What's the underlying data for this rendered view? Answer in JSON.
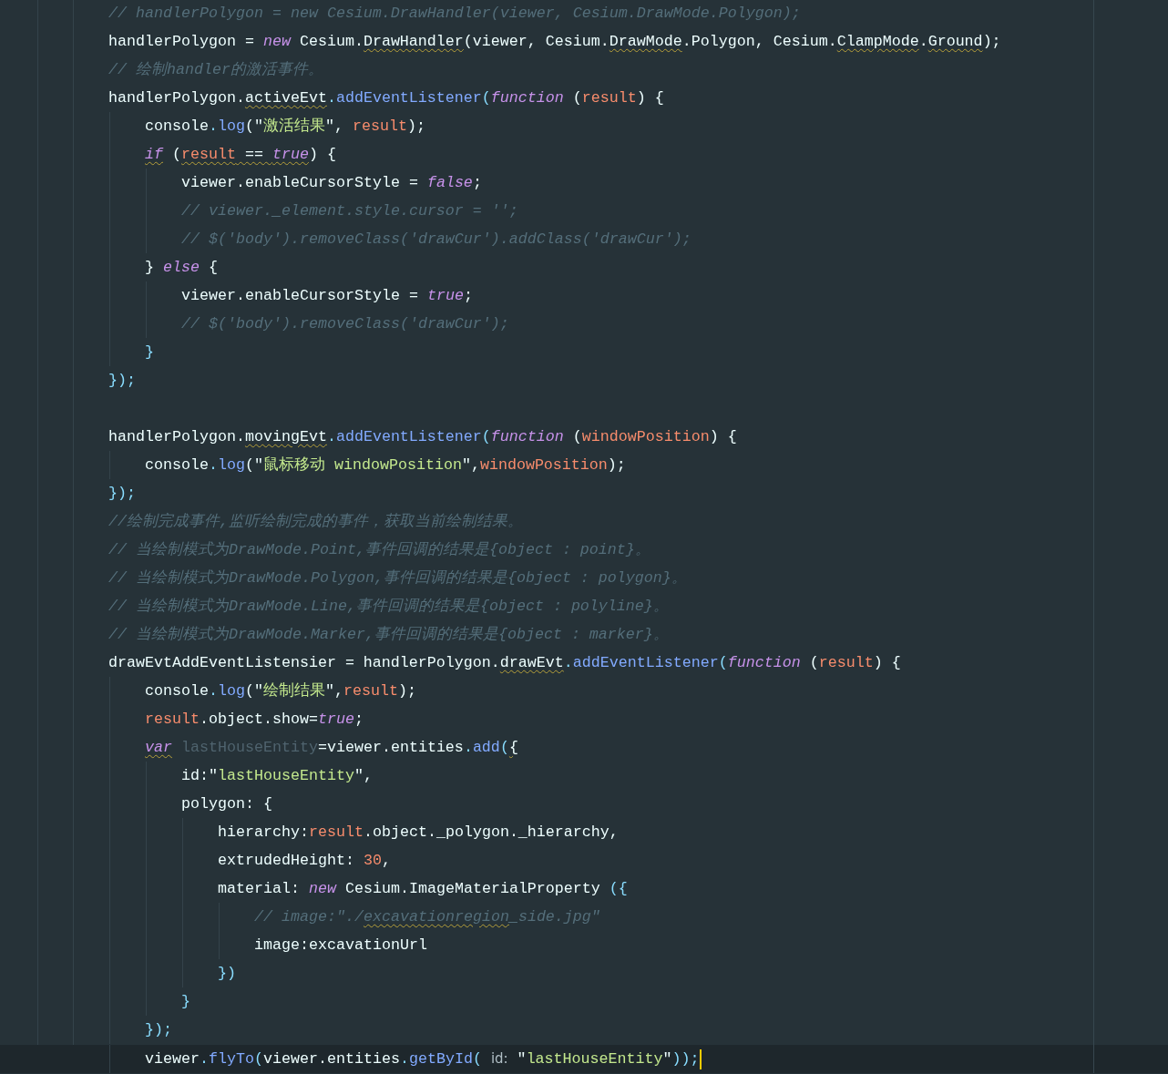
{
  "editor": {
    "lines": [
      {
        "tokens": [
          {
            "kind": "comment",
            "text": "// handlerPolygon = new Cesium.DrawHandler(viewer, Cesium.DrawMode.Polygon);"
          }
        ]
      },
      {
        "tokens": [
          {
            "kind": "text",
            "text": "handlerPolygon = "
          },
          {
            "kind": "keyword",
            "text": "new"
          },
          {
            "kind": "text",
            "text": " Cesium."
          },
          {
            "kind": "text",
            "text": "DrawHandler",
            "warning": true
          },
          {
            "kind": "text",
            "text": "(viewer, Cesium."
          },
          {
            "kind": "text",
            "text": "DrawMode",
            "warning": true
          },
          {
            "kind": "text",
            "text": ".Polygon, Cesium."
          },
          {
            "kind": "text",
            "text": "ClampMode",
            "warning": true
          },
          {
            "kind": "text",
            "text": "."
          },
          {
            "kind": "text",
            "text": "Ground",
            "warning": true
          },
          {
            "kind": "text",
            "text": ");"
          }
        ]
      },
      {
        "tokens": [
          {
            "kind": "comment",
            "text": "// 绘制handler的激活事件。"
          }
        ]
      },
      {
        "tokens": [
          {
            "kind": "text",
            "text": "handlerPolygon."
          },
          {
            "kind": "text",
            "text": "activeEvt",
            "warning": true
          },
          {
            "kind": "bracket",
            "text": "."
          },
          {
            "kind": "func",
            "text": "addEventListener"
          },
          {
            "kind": "bracket",
            "text": "("
          },
          {
            "kind": "keyword",
            "text": "function"
          },
          {
            "kind": "text",
            "text": " ("
          },
          {
            "kind": "param",
            "text": "result"
          },
          {
            "kind": "text",
            "text": ") {"
          }
        ],
        "children": [
          {
            "tokens": [
              {
                "kind": "text",
                "text": "console"
              },
              {
                "kind": "bracket",
                "text": "."
              },
              {
                "kind": "func",
                "text": "log"
              },
              {
                "kind": "text",
                "text": "(\""
              },
              {
                "kind": "string",
                "text": "激活结果"
              },
              {
                "kind": "text",
                "text": "\", "
              },
              {
                "kind": "param",
                "text": "result"
              },
              {
                "kind": "text",
                "text": ");"
              }
            ]
          },
          {
            "tokens": [
              {
                "kind": "keyword",
                "text": "if",
                "warning": true
              },
              {
                "kind": "text",
                "text": " ("
              },
              {
                "kind": "param",
                "text": "result",
                "warning": true
              },
              {
                "kind": "text",
                "text": " == ",
                "warning": true
              },
              {
                "kind": "keyword",
                "text": "true",
                "warning": true
              },
              {
                "kind": "text",
                "text": ") {"
              }
            ],
            "children": [
              {
                "tokens": [
                  {
                    "kind": "text",
                    "text": "viewer.enableCursorStyle = "
                  },
                  {
                    "kind": "keyword",
                    "text": "false"
                  },
                  {
                    "kind": "text",
                    "text": ";"
                  }
                ]
              },
              {
                "tokens": [
                  {
                    "kind": "comment",
                    "text": "// viewer._element.style.cursor = '';"
                  }
                ]
              },
              {
                "tokens": [
                  {
                    "kind": "comment",
                    "text": "// $('body').removeClass('drawCur').addClass('drawCur');"
                  }
                ]
              }
            ]
          },
          {
            "tokens": [
              {
                "kind": "text",
                "text": "} "
              },
              {
                "kind": "keyword",
                "text": "else"
              },
              {
                "kind": "text",
                "text": " {"
              }
            ],
            "children": [
              {
                "tokens": [
                  {
                    "kind": "text",
                    "text": "viewer.enableCursorStyle = "
                  },
                  {
                    "kind": "keyword",
                    "text": "true"
                  },
                  {
                    "kind": "text",
                    "text": ";"
                  }
                ]
              },
              {
                "tokens": [
                  {
                    "kind": "comment",
                    "text": "// $('body').removeClass('drawCur');"
                  }
                ]
              }
            ]
          },
          {
            "tokens": [
              {
                "kind": "bracket",
                "text": "}"
              }
            ]
          }
        ]
      },
      {
        "tokens": [
          {
            "kind": "bracket",
            "text": "});"
          }
        ]
      },
      {
        "kind": "blank"
      },
      {
        "tokens": [
          {
            "kind": "text",
            "text": "handlerPolygon."
          },
          {
            "kind": "text",
            "text": "movingEvt",
            "warning": true
          },
          {
            "kind": "bracket",
            "text": "."
          },
          {
            "kind": "func",
            "text": "addEventListener"
          },
          {
            "kind": "bracket",
            "text": "("
          },
          {
            "kind": "keyword",
            "text": "function"
          },
          {
            "kind": "text",
            "text": " ("
          },
          {
            "kind": "param",
            "text": "windowPosition"
          },
          {
            "kind": "text",
            "text": ") {"
          }
        ],
        "children": [
          {
            "tokens": [
              {
                "kind": "text",
                "text": "console"
              },
              {
                "kind": "bracket",
                "text": "."
              },
              {
                "kind": "func",
                "text": "log"
              },
              {
                "kind": "text",
                "text": "(\""
              },
              {
                "kind": "string",
                "text": "鼠标移动 windowPosition"
              },
              {
                "kind": "text",
                "text": "\","
              },
              {
                "kind": "param",
                "text": "windowPosition"
              },
              {
                "kind": "text",
                "text": ");"
              }
            ]
          }
        ]
      },
      {
        "tokens": [
          {
            "kind": "bracket",
            "text": "});"
          }
        ]
      },
      {
        "tokens": [
          {
            "kind": "comment",
            "text": "//绘制完成事件,监听绘制完成的事件，获取当前绘制结果。"
          }
        ]
      },
      {
        "tokens": [
          {
            "kind": "comment",
            "text": "// 当绘制模式为DrawMode.Point,事件回调的结果是{object : point}。"
          }
        ]
      },
      {
        "tokens": [
          {
            "kind": "comment",
            "text": "// 当绘制模式为DrawMode.Polygon,事件回调的结果是{object : polygon}。"
          }
        ]
      },
      {
        "tokens": [
          {
            "kind": "comment",
            "text": "// 当绘制模式为DrawMode.Line,事件回调的结果是{object : polyline}。"
          }
        ]
      },
      {
        "tokens": [
          {
            "kind": "comment",
            "text": "// 当绘制模式为DrawMode.Marker,事件回调的结果是{object : marker}。"
          }
        ]
      },
      {
        "tokens": [
          {
            "kind": "text",
            "text": "drawEvtAddEventListensier = handlerPolygon."
          },
          {
            "kind": "text",
            "text": "drawEvt",
            "warning": true
          },
          {
            "kind": "bracket",
            "text": "."
          },
          {
            "kind": "func",
            "text": "addEventListener"
          },
          {
            "kind": "bracket",
            "text": "("
          },
          {
            "kind": "keyword",
            "text": "function"
          },
          {
            "kind": "text",
            "text": " ("
          },
          {
            "kind": "param",
            "text": "result"
          },
          {
            "kind": "text",
            "text": ") {"
          }
        ],
        "children": [
          {
            "tokens": [
              {
                "kind": "text",
                "text": "console"
              },
              {
                "kind": "bracket",
                "text": "."
              },
              {
                "kind": "func",
                "text": "log"
              },
              {
                "kind": "text",
                "text": "(\""
              },
              {
                "kind": "string",
                "text": "绘制结果"
              },
              {
                "kind": "text",
                "text": "\","
              },
              {
                "kind": "param",
                "text": "result"
              },
              {
                "kind": "text",
                "text": ");"
              }
            ]
          },
          {
            "tokens": [
              {
                "kind": "param",
                "text": "result"
              },
              {
                "kind": "text",
                "text": ".object.show="
              },
              {
                "kind": "keyword",
                "text": "true"
              },
              {
                "kind": "text",
                "text": ";"
              }
            ]
          },
          {
            "tokens": [
              {
                "kind": "keyword",
                "text": "var",
                "warning": true
              },
              {
                "kind": "unused",
                "text": " lastHouseEntity"
              },
              {
                "kind": "text",
                "text": "=viewer.entities"
              },
              {
                "kind": "bracket",
                "text": "."
              },
              {
                "kind": "func",
                "text": "add"
              },
              {
                "kind": "bracket",
                "text": "("
              },
              {
                "kind": "text",
                "text": "{",
                "warning": true
              }
            ],
            "children": [
              {
                "tokens": [
                  {
                    "kind": "text",
                    "text": "id:\""
                  },
                  {
                    "kind": "string",
                    "text": "lastHouseEntity"
                  },
                  {
                    "kind": "text",
                    "text": "\","
                  }
                ]
              },
              {
                "tokens": [
                  {
                    "kind": "text",
                    "text": "polygon: {"
                  }
                ],
                "children": [
                  {
                    "tokens": [
                      {
                        "kind": "text",
                        "text": "hierarchy:"
                      },
                      {
                        "kind": "param",
                        "text": "result"
                      },
                      {
                        "kind": "text",
                        "text": ".object._polygon._hierarchy,"
                      }
                    ]
                  },
                  {
                    "tokens": [
                      {
                        "kind": "text",
                        "text": "extrudedHeight: "
                      },
                      {
                        "kind": "number",
                        "text": "30"
                      },
                      {
                        "kind": "text",
                        "text": ","
                      }
                    ]
                  },
                  {
                    "tokens": [
                      {
                        "kind": "text",
                        "text": "material: "
                      },
                      {
                        "kind": "keyword",
                        "text": "new"
                      },
                      {
                        "kind": "text",
                        "text": " Cesium.ImageMaterialProperty "
                      },
                      {
                        "kind": "bracket",
                        "text": "({"
                      }
                    ],
                    "children": [
                      {
                        "tokens": [
                          {
                            "kind": "comment",
                            "text": "// image:\"./"
                          },
                          {
                            "kind": "comment",
                            "text": "excavationregion",
                            "warning": true
                          },
                          {
                            "kind": "comment",
                            "text": "_side.jpg\""
                          }
                        ]
                      },
                      {
                        "tokens": [
                          {
                            "kind": "text",
                            "text": "image:excavationUrl"
                          }
                        ]
                      }
                    ]
                  },
                  {
                    "tokens": [
                      {
                        "kind": "bracket",
                        "text": "})"
                      }
                    ]
                  }
                ]
              },
              {
                "tokens": [
                  {
                    "kind": "bracket",
                    "text": "}"
                  }
                ]
              }
            ]
          },
          {
            "tokens": [
              {
                "kind": "bracket",
                "text": "});"
              }
            ]
          },
          {
            "current_line": true,
            "tokens": [
              {
                "kind": "text",
                "text": "viewer"
              },
              {
                "kind": "bracket",
                "text": "."
              },
              {
                "kind": "func",
                "text": "flyTo"
              },
              {
                "kind": "bracket",
                "text": "("
              },
              {
                "kind": "text",
                "text": "viewer.entities"
              },
              {
                "kind": "bracket",
                "text": "."
              },
              {
                "kind": "func",
                "text": "getById"
              },
              {
                "kind": "bracket",
                "text": "( "
              },
              {
                "kind": "hint",
                "text": "id:"
              },
              {
                "kind": "text",
                "text": " \""
              },
              {
                "kind": "string",
                "text": "lastHouseEntity"
              },
              {
                "kind": "text",
                "text": "\""
              },
              {
                "kind": "bracket",
                "text": "));"
              }
            ]
          }
        ]
      }
    ]
  }
}
